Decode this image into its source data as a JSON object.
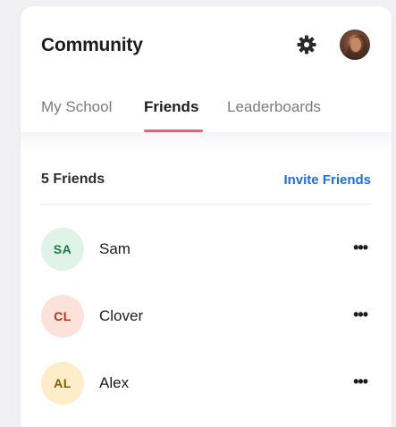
{
  "header": {
    "title": "Community",
    "settings_icon": "gear-icon",
    "profile_icon": "user-avatar"
  },
  "tabs": [
    {
      "label": "My School",
      "active": false
    },
    {
      "label": "Friends",
      "active": true
    },
    {
      "label": "Leaderboards",
      "active": false
    }
  ],
  "friends": {
    "count_label": "5 Friends",
    "invite_label": "Invite Friends",
    "items": [
      {
        "initials": "SA",
        "name": "Sam",
        "bg": "#dff3e8",
        "fg": "#1b7a43",
        "more": "•••"
      },
      {
        "initials": "CL",
        "name": "Clover",
        "bg": "#fde2dc",
        "fg": "#b3361f",
        "more": "•••"
      },
      {
        "initials": "AL",
        "name": "Alex",
        "bg": "#fdedc9",
        "fg": "#8a5a06",
        "more": "•••"
      }
    ]
  },
  "colors": {
    "accent_tab": "#ec5f75",
    "link": "#1f6fe0"
  }
}
